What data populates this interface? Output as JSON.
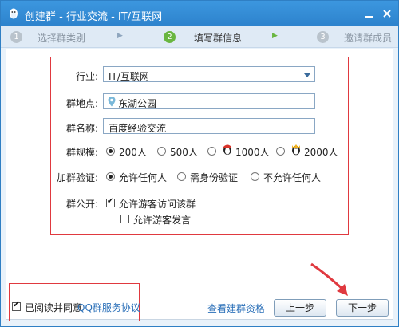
{
  "titlebar": {
    "title": "创建群 - 行业交流 - IT/互联网"
  },
  "steps": [
    {
      "num": "1",
      "label": "选择群类别"
    },
    {
      "num": "2",
      "label": "填写群信息"
    },
    {
      "num": "3",
      "label": "邀请群成员"
    }
  ],
  "form": {
    "industry_label": "行业:",
    "industry_value": "IT/互联网",
    "location_label": "群地点:",
    "location_value": "东湖公园",
    "name_label": "群名称:",
    "name_value": "百度经验交流",
    "size_label": "群规模:",
    "size_options": [
      "200人",
      "500人",
      "1000人",
      "2000人"
    ],
    "verify_label": "加群验证:",
    "verify_options": [
      "允许任何人",
      "需身份验证",
      "不允许任何人"
    ],
    "public_label": "群公开:",
    "public_options": [
      "允许游客访问该群",
      "允许游客发言"
    ]
  },
  "footer": {
    "agree_text": "已阅读并同意",
    "agree_link": "QQ群服务协议",
    "view_qualification": "查看建群资格",
    "prev_button": "上一步",
    "next_button": "下一步"
  },
  "colors": {
    "accent": "#2d82cc",
    "step_active": "#69b640",
    "highlight": "#e0393f"
  }
}
